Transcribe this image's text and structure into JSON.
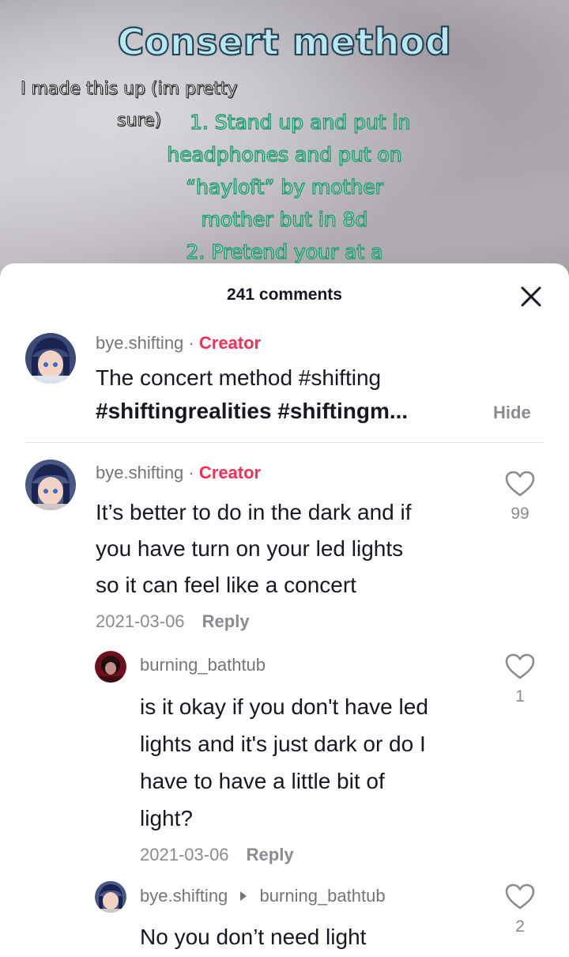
{
  "video": {
    "title": "Consert method",
    "note_line1": "I made this up (im pretty",
    "note_line2": "sure)",
    "step_lines": [
      "1. Stand up and put in",
      "headphones and put on",
      "“hayloft” by mother",
      "mother but in 8d",
      "2. Pretend your at a"
    ]
  },
  "sheet": {
    "comment_count": "241 comments",
    "close_icon": "close-icon"
  },
  "caption": {
    "username": "bye.shifting",
    "separator": "·",
    "badge": "Creator",
    "line1": "The concert method #shifting",
    "line2": "#shiftingrealities #shiftingm...",
    "hide_label": "Hide"
  },
  "comments": [
    {
      "username": "bye.shifting",
      "separator": "·",
      "badge": "Creator",
      "lines": [
        "It’s better to do in the dark and if",
        "you have turn on your led lights",
        "so it can feel like a concert"
      ],
      "date": "2021-03-06",
      "reply_label": "Reply",
      "likes": "99"
    }
  ],
  "replies": [
    {
      "username": "burning_bathtub",
      "lines": [
        "is it okay if you don't have led",
        "lights and it's just dark or do I",
        "have to have a little bit of",
        "light?"
      ],
      "date": "2021-03-06",
      "reply_label": "Reply",
      "likes": "1"
    },
    {
      "username": "bye.shifting",
      "reply_to": "burning_bathtub",
      "lines": [
        "No you don’t need light"
      ],
      "likes": "2"
    }
  ],
  "colors": {
    "creator": "#fe2c55",
    "muted": "#8a8b91",
    "text": "#161823"
  }
}
